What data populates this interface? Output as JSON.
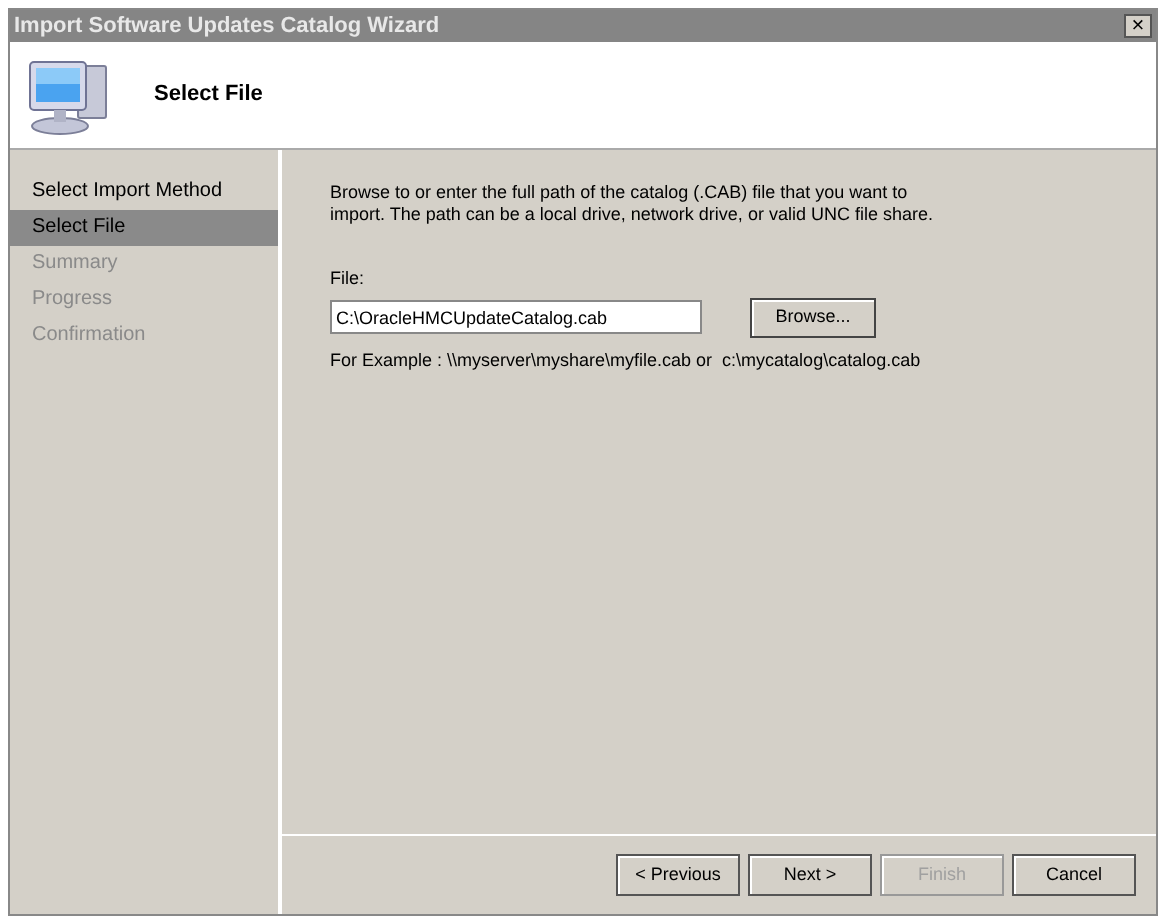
{
  "window": {
    "title": "Import Software Updates Catalog Wizard",
    "close": "×"
  },
  "header": {
    "title": "Select File"
  },
  "steps": [
    {
      "label": "Select Import Method",
      "selected": false,
      "disabled": false
    },
    {
      "label": "Select File",
      "selected": true,
      "disabled": false
    },
    {
      "label": "Summary",
      "selected": false,
      "disabled": true
    },
    {
      "label": "Progress",
      "selected": false,
      "disabled": true
    },
    {
      "label": "Confirmation",
      "selected": false,
      "disabled": true
    }
  ],
  "instructions": "Browse to or enter the full path of the catalog (.CAB) file that you want to import. The path can be a local drive, network drive, or valid UNC file share.",
  "file_label": "File:",
  "file_value": "C:\\OracleHMCUpdateCatalog.cab",
  "browse": "Browse...",
  "example": "For Example : \\\\myserver\\myshare\\myfile.cab or  c:\\mycatalog\\catalog.cab",
  "buttons": [
    {
      "label": "< Previous",
      "disabled": false
    },
    {
      "label": "Next >",
      "disabled": false
    },
    {
      "label": "Finish",
      "disabled": true
    },
    {
      "label": "Cancel",
      "disabled": false
    }
  ]
}
